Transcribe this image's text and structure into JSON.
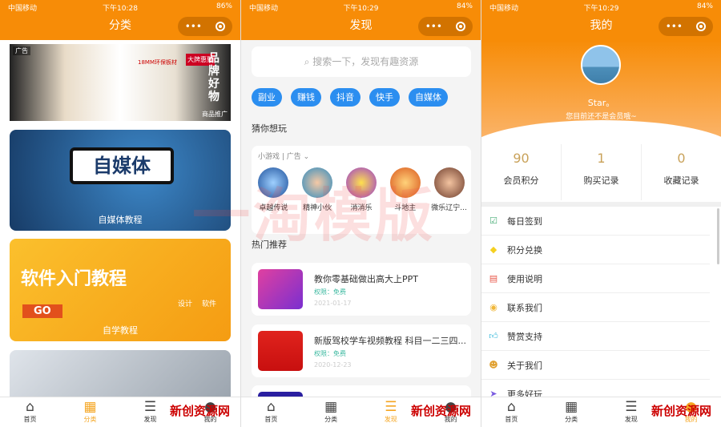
{
  "screens": [
    {
      "status": {
        "carrier": "中国移动",
        "time": "下午10:28",
        "battery": "86%"
      },
      "title": "分类"
    },
    {
      "status": {
        "carrier": "中国移动",
        "time": "下午10:29",
        "battery": "84%"
      },
      "title": "发现"
    },
    {
      "status": {
        "carrier": "中国移动",
        "time": "下午10:29",
        "battery": "84%"
      },
      "title": "我的"
    }
  ],
  "tabbar": [
    {
      "label": "首页",
      "icon": "home-icon"
    },
    {
      "label": "分类",
      "icon": "grid-search-icon"
    },
    {
      "label": "发现",
      "icon": "list-icon"
    },
    {
      "label": "我的",
      "icon": "user-icon"
    }
  ],
  "category": {
    "ad": {
      "badge": "广告",
      "tag": "商品推广",
      "text1": "18MM环保板材",
      "text2": "品牌好物",
      "text3": "大牌惠聚"
    },
    "cards": [
      {
        "caption": "自媒体教程",
        "art": "自媒体"
      },
      {
        "caption": "自学教程",
        "art": "软件入门教程",
        "go": "GO",
        "tag1": "设计",
        "tag2": "软件"
      },
      {
        "caption": ""
      }
    ]
  },
  "discover": {
    "search_placeholder": "搜索一下，发现有趣资源",
    "tags": [
      "副业",
      "赚钱",
      "抖音",
      "快手",
      "自媒体"
    ],
    "guess_title": "猜你想玩",
    "games_header": "小游戏",
    "games_ad": "广告",
    "games": [
      "卓越传说",
      "精神小伙",
      "消消乐",
      "斗地主",
      "微乐辽宁..."
    ],
    "hot_title": "热门推荐",
    "items": [
      {
        "title": "教你零基础做出高大上PPT",
        "perm": "权限：免费",
        "date": "2021-01-17"
      },
      {
        "title": "新版驾校学车视频教程 科目一二三四...",
        "perm": "权限：免费",
        "date": "2020-12-23"
      },
      {
        "title": "...",
        "perm": "",
        "date": ""
      }
    ]
  },
  "mine": {
    "name": "Star。",
    "subtitle": "您目前还不是会员哦~",
    "stats": [
      {
        "value": "90",
        "label": "会员积分"
      },
      {
        "value": "1",
        "label": "购买记录"
      },
      {
        "value": "0",
        "label": "收藏记录"
      }
    ],
    "menu": [
      {
        "label": "每日签到",
        "icon": "calendar-check-icon",
        "color": "#4caf7a"
      },
      {
        "label": "积分兑换",
        "icon": "diamond-icon",
        "color": "#f5d020"
      },
      {
        "label": "使用说明",
        "icon": "document-icon",
        "color": "#e8574a"
      },
      {
        "label": "联系我们",
        "icon": "chat-icon",
        "color": "#f0b73a"
      },
      {
        "label": "赞赏支持",
        "icon": "thumbs-up-icon",
        "color": "#2bb5d8"
      },
      {
        "label": "关于我们",
        "icon": "people-icon",
        "color": "#e0a030"
      },
      {
        "label": "更多好玩",
        "icon": "paper-plane-icon",
        "color": "#7a5ce0"
      }
    ]
  },
  "watermarks": {
    "center": "一淘模版",
    "bottom": "新创资源网"
  },
  "colors": {
    "brand": "#f78c07",
    "tag": "#2b8ef0",
    "active_tab": "#f5a623"
  }
}
